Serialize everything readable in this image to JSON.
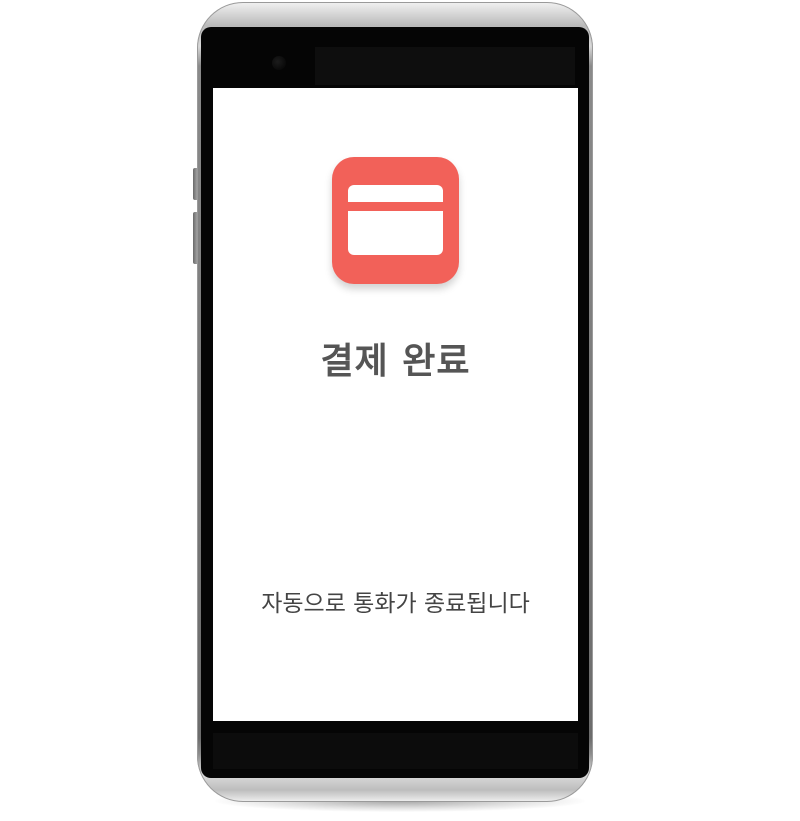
{
  "screen": {
    "icon": "credit-card-icon",
    "title": "결제 완료",
    "message": "자동으로 통화가 종료됩니다"
  },
  "colors": {
    "accent": "#f26159",
    "title_text": "#555555",
    "message_text": "#444444",
    "screen_background": "#ffffff"
  }
}
